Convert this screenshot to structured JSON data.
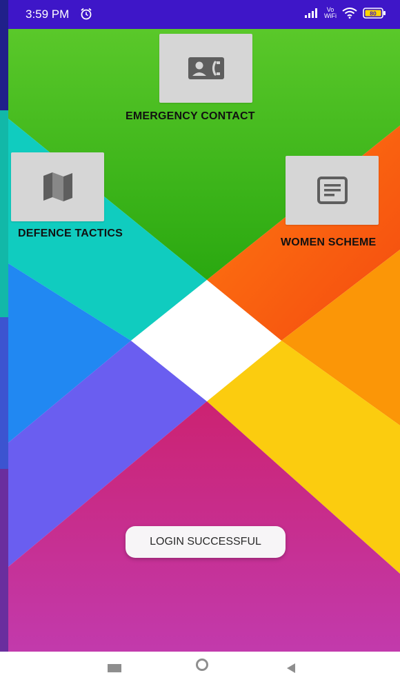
{
  "status_bar": {
    "time": "3:59 PM",
    "alarm_icon": "alarm-clock-icon",
    "vo_label": "Vo",
    "wifi_label": "WiFi",
    "battery": "80"
  },
  "tiles": {
    "emergency_contact": {
      "label": "EMERGENCY CONTACT",
      "icon": "contact-phone-icon"
    },
    "defence_tactics": {
      "label": "DEFENCE TACTICS",
      "icon": "map-icon"
    },
    "women_scheme": {
      "label": "WOMEN SCHEME",
      "icon": "article-icon"
    }
  },
  "toast": {
    "message": "LOGIN SUCCESSFUL"
  },
  "colors": {
    "status_bar": "#3e16c8",
    "top_green": "#36b81a",
    "left_teal": "#10ccbf",
    "right_orange": "#f95a12",
    "left_blue": "#2188f2",
    "right_amber": "#fb9607",
    "lower_left_violet": "#6a5ef0",
    "lower_right_yellow": "#fbcc0f",
    "bottom_magenta": "#c42a8c",
    "center_white": "#ffffff",
    "tile_bg": "#d6d6d6",
    "icon_gray": "#5e5e5e"
  },
  "nav_bar": {
    "recents_icon": "square-recents-icon",
    "home_icon": "circle-home-icon",
    "back_icon": "triangle-back-icon"
  }
}
